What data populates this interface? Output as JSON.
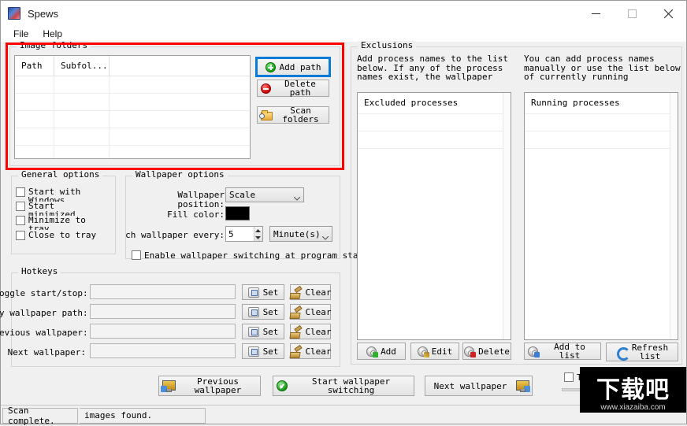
{
  "window": {
    "title": "Spews",
    "icon": "app-icon",
    "controls": {
      "minimize": "minimize-icon",
      "maximize": "maximize-icon",
      "close": "close-icon"
    }
  },
  "menubar": {
    "items": [
      "File",
      "Help"
    ]
  },
  "image_folders": {
    "legend": "Image folders",
    "columns": [
      "Path",
      "Subfol..."
    ],
    "rows": [],
    "empty_row_count": 6,
    "buttons": [
      {
        "label": "Add path",
        "icon": "plus-circle-icon",
        "focused": true
      },
      {
        "label": "Delete path",
        "icon": "minus-circle-icon",
        "focused": false
      },
      {
        "label": "Scan folders",
        "icon": "folder-search-icon",
        "focused": false
      }
    ],
    "highlight_color": "#ff0000"
  },
  "general_options": {
    "legend": "General options",
    "checkboxes": [
      {
        "label": "Start with\nWindows",
        "checked": false
      },
      {
        "label": "Start\nminimized",
        "checked": false
      },
      {
        "label": "Minimize to\ntray",
        "checked": false
      },
      {
        "label": "Close to tray",
        "checked": false
      }
    ]
  },
  "wallpaper_options": {
    "legend": "Wallpaper options",
    "position_label": "Wallpaper position:",
    "position_value": "Scale",
    "fill_color_label": "Fill color:",
    "fill_color_value": "#000000",
    "interval_label": "ch wallpaper every:",
    "interval_value": "5",
    "interval_unit": "Minute(s)",
    "enable_switching_label": "Enable wallpaper switching at program startup",
    "enable_switching_checked": false
  },
  "hotkeys": {
    "legend": "Hotkeys",
    "rows": [
      {
        "label": "oggle start/stop:",
        "value": "",
        "set": "Set",
        "clear": "Clear"
      },
      {
        "label": "y wallpaper path:",
        "value": "",
        "set": "Set",
        "clear": "Clear"
      },
      {
        "label": "evious wallpaper:",
        "value": "",
        "set": "Set",
        "clear": "Clear"
      },
      {
        "label": "Next wallpaper:",
        "value": "",
        "set": "Set",
        "clear": "Clear"
      }
    ]
  },
  "exclusions": {
    "legend": "Exclusions",
    "left_description": "Add process names to the list\nbelow.  If any of the process\nnames exist, the wallpaper will",
    "right_description": "You can add process names\nmanually or use the list below\nof currently running processes.",
    "excluded_list_title": "Excluded processes",
    "running_list_title": "Running processes",
    "excluded_buttons": [
      {
        "label": "Add",
        "icon": "gear-plus-icon"
      },
      {
        "label": "Edit",
        "icon": "gear-pencil-icon"
      },
      {
        "label": "Delete",
        "icon": "gear-minus-icon"
      }
    ],
    "running_buttons": [
      {
        "label": "Add to list",
        "icon": "gear-arrow-icon"
      },
      {
        "label": "Refresh\nlist",
        "icon": "refresh-icon"
      }
    ]
  },
  "bottom_bar": {
    "previous_label": "Previous\nwallpaper",
    "start_label": "Start wallpaper switching",
    "next_label": "Next wallpaper",
    "transparency_label": "Transparency",
    "transparency_checked": false
  },
  "statusbar": {
    "message": "Scan complete.",
    "images_found": "images found."
  },
  "watermark": {
    "text_cn": "下载吧",
    "url": "www.xiazaiba.com"
  }
}
